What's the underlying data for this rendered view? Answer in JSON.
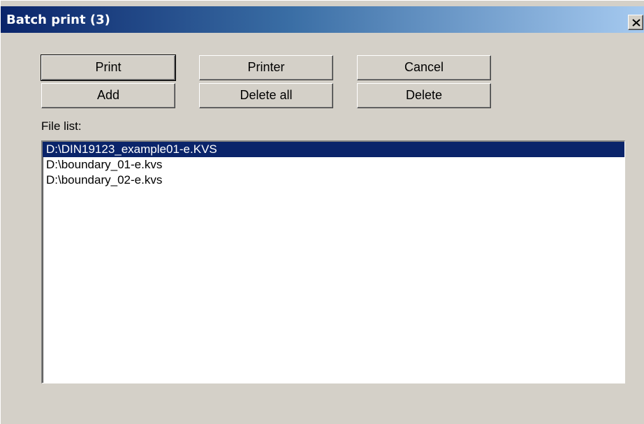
{
  "window": {
    "title": "Batch print (3)"
  },
  "buttons": {
    "print": "Print",
    "printer": "Printer",
    "cancel": "Cancel",
    "add": "Add",
    "delete_all": "Delete all",
    "delete": "Delete"
  },
  "file_list": {
    "label": "File list:",
    "items": [
      "D:\\DIN19123_example01-e.KVS",
      "D:\\boundary_01-e.kvs",
      "D:\\boundary_02-e.kvs"
    ],
    "selected_index": 0
  },
  "colors": {
    "titlebar_start": "#0a246a",
    "titlebar_end": "#a6caf0",
    "face": "#d4d0c8",
    "selection": "#0a246a"
  }
}
